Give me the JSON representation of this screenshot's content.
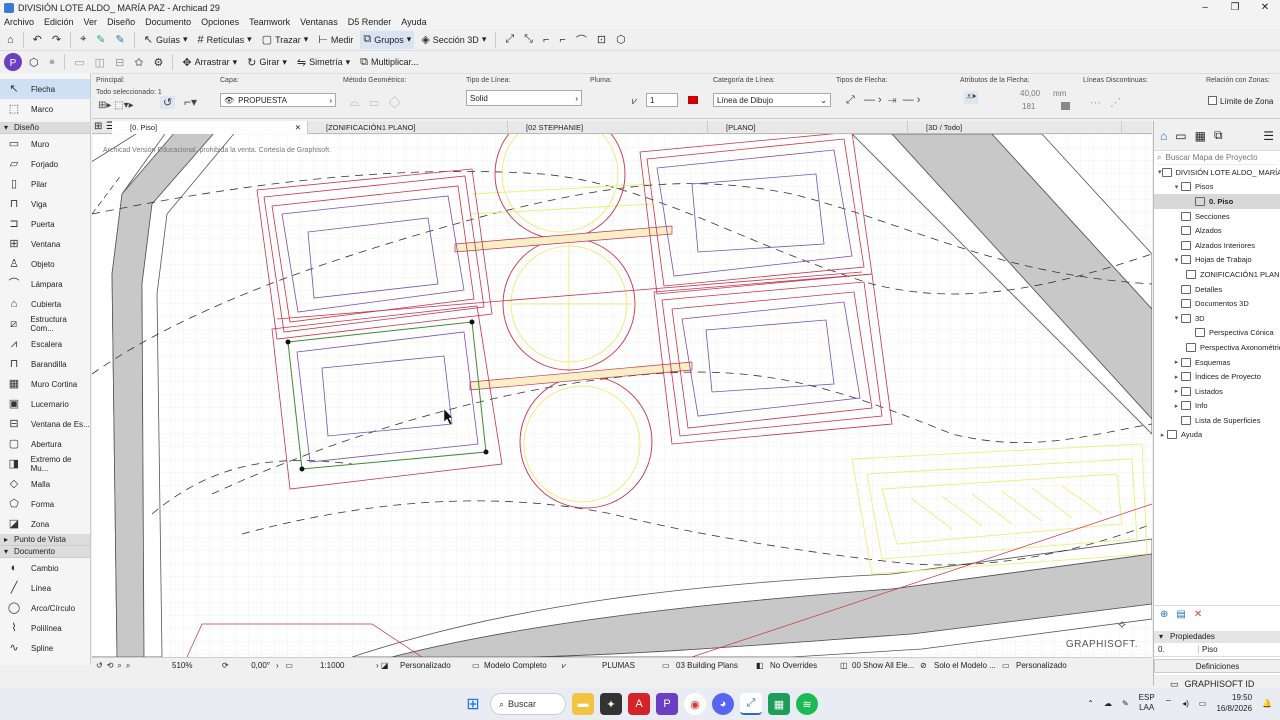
{
  "window": {
    "title": "DIVISIÓN LOTE ALDO_ MARÍA PAZ - Archicad 29"
  },
  "menu": [
    "Archivo",
    "Edición",
    "Ver",
    "Diseño",
    "Documento",
    "Opciones",
    "Teamwork",
    "Ventanas",
    "D5 Render",
    "Ayuda"
  ],
  "toolbar": {
    "guias": "Guías",
    "reticulas": "Retículas",
    "trazar": "Trazar",
    "medir": "Medir",
    "grupos": "Grupos",
    "seccion3d": "Sección 3D"
  },
  "toolbar2": {
    "arrastrar": "Arrastrar",
    "girar": "Girar",
    "simetria": "Simetría",
    "multiplicar": "Multiplicar..."
  },
  "infobox": {
    "principal": "Principal:",
    "todo_sel": "Todo seleccionado: 1",
    "capa_label": "Capa:",
    "capa_value": "PROPUESTA",
    "metodo_label": "Método Geométrico:",
    "tipo_linea_label": "Tipo de Línea:",
    "tipo_linea_value": "Solid",
    "pluma_label": "Pluma:",
    "pluma_value": "1",
    "categoria_label": "Categoría de Línea:",
    "categoria_value": "Línea de Dibujo",
    "tipos_flecha_label": "Tipos de Flecha:",
    "atributos_label": "Atributos de la Flecha:",
    "size_value": "40,00",
    "size_unit": "mm",
    "pen_value": "181",
    "discontinuas_label": "Líneas Discontinuas:",
    "relacion_label": "Relación con Zonas:",
    "limite_label": "Límite de Zona"
  },
  "leftpanel": {
    "arrow": "Flecha",
    "marquee": "Marco",
    "diseno_head": "Diseño",
    "diseno_items": [
      "Muro",
      "Forjado",
      "Pilar",
      "Viga",
      "Puerta",
      "Ventana",
      "Objeto",
      "Lámpara",
      "Cubierta",
      "Estructura Com...",
      "Escalera",
      "Barandilla",
      "Muro Cortina",
      "Lucernario",
      "Ventana de Es...",
      "Abertura",
      "Extremo de Mu...",
      "Malla",
      "Forma",
      "Zona"
    ],
    "punto_head": "Punto de Vista",
    "documento_head": "Documento",
    "doc_items": [
      "Cambio",
      "Línea",
      "Arco/Círculo",
      "Polilínea",
      "Spline"
    ]
  },
  "tabs": [
    "[0. Piso]",
    "[ZONIFICACIÓN1 PLANO]",
    "[02 STEPHANIE]",
    "[PLANO]",
    "[3D / Todo]"
  ],
  "canvas": {
    "watermark": "Archicad Versión Educacional, prohibida la venta. Cortesía de Graphisoft.",
    "logo": "GRAPHISOFT."
  },
  "status": {
    "zoom": "510%",
    "angle": "0,00°",
    "scale": "1:1000",
    "personalizado": "Personalizado",
    "modelo": "Modelo Completo",
    "plumas": "PLUMAS",
    "plans": "03 Building Plans",
    "overrides": "No Overrides",
    "show": "00 Show All Ele...",
    "solo": "Solo el Modelo ...",
    "personalizado2": "Personalizado"
  },
  "navigator": {
    "search": "Buscar Mapa de Proyecto",
    "nodes": [
      {
        "label": "DIVISIÓN LOTE ALDO_ MARÍA PAZ",
        "level": 0,
        "toggle": "▾"
      },
      {
        "label": "Pisos",
        "level": 1,
        "toggle": "▾"
      },
      {
        "label": "0. Piso",
        "level": 2,
        "toggle": "",
        "selected": true
      },
      {
        "label": "Secciones",
        "level": 1,
        "toggle": ""
      },
      {
        "label": "Alzados",
        "level": 1,
        "toggle": ""
      },
      {
        "label": "Alzados Interiores",
        "level": 1,
        "toggle": ""
      },
      {
        "label": "Hojas de Trabajo",
        "level": 1,
        "toggle": "▾"
      },
      {
        "label": "ZONIFICACIÓN1 PLANO (Inde",
        "level": 2,
        "toggle": ""
      },
      {
        "label": "Detalles",
        "level": 1,
        "toggle": ""
      },
      {
        "label": "Documentos 3D",
        "level": 1,
        "toggle": ""
      },
      {
        "label": "3D",
        "level": 1,
        "toggle": "▾"
      },
      {
        "label": "Perspectiva Cónica",
        "level": 2,
        "toggle": ""
      },
      {
        "label": "Perspectiva Axonométrica",
        "level": 2,
        "toggle": ""
      },
      {
        "label": "Esquemas",
        "level": 1,
        "toggle": "▸"
      },
      {
        "label": "Índices de Proyecto",
        "level": 1,
        "toggle": "▸"
      },
      {
        "label": "Listados",
        "level": 1,
        "toggle": "▸"
      },
      {
        "label": "Info",
        "level": 1,
        "toggle": "▸"
      },
      {
        "label": "Lista de Superficies",
        "level": 1,
        "toggle": ""
      },
      {
        "label": "Ayuda",
        "level": 0,
        "toggle": "▸"
      }
    ],
    "propiedades": "Propiedades",
    "prop_num": "0.",
    "prop_val": "Piso",
    "definiciones": "Definiciones",
    "graphisoft_id": "GRAPHISOFT ID"
  },
  "taskbar": {
    "search": "Buscar",
    "lang1": "ESP",
    "lang2": "LAA",
    "time": "19:50",
    "date": "16/8/2026"
  },
  "colors": {
    "accent": "#0078d4",
    "red": "#c8324a",
    "purple": "#6f4fb5",
    "yellow": "#f3ef7a",
    "green": "#3d8a2f"
  }
}
